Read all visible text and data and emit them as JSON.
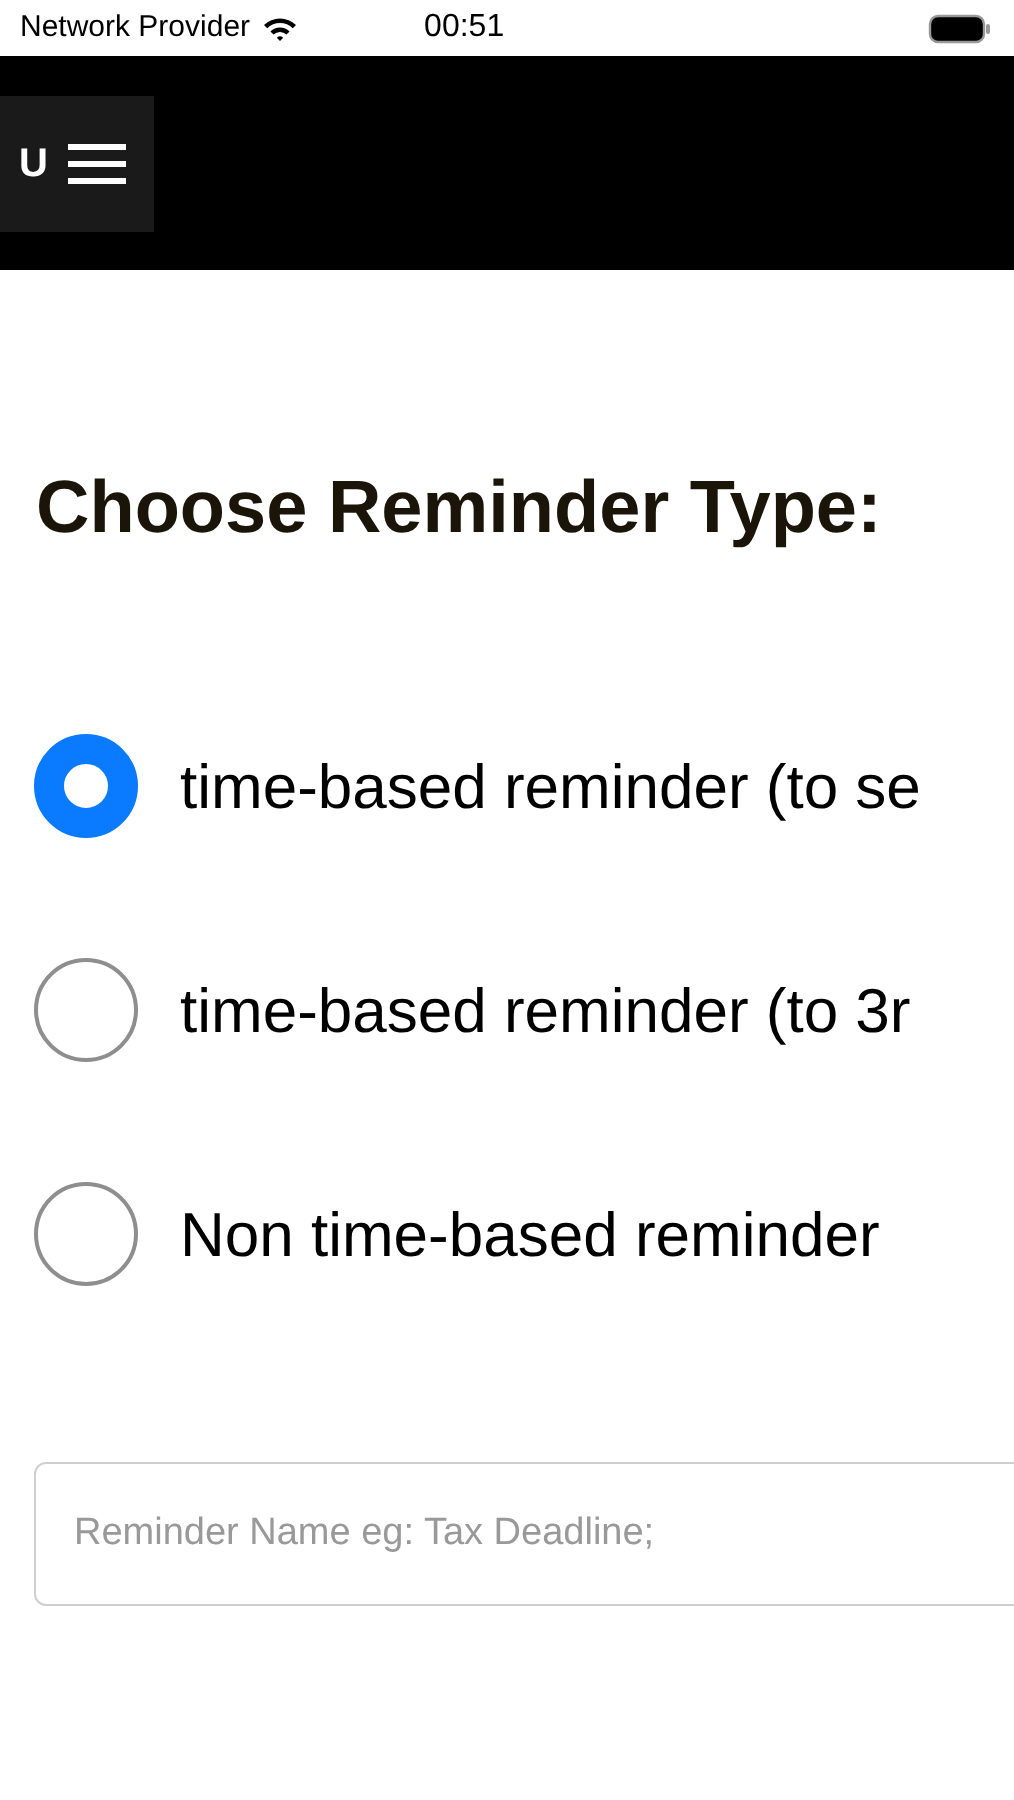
{
  "status_bar": {
    "carrier": "Network Provider",
    "time": "00:51"
  },
  "header": {
    "menu_button": {
      "label": "U"
    }
  },
  "heading": "Choose Reminder Type:",
  "options": [
    {
      "label": "time-based reminder (to se",
      "selected": true
    },
    {
      "label": "time-based reminder (to 3r",
      "selected": false
    },
    {
      "label": "Non time-based reminder",
      "selected": false
    }
  ],
  "name_field": {
    "placeholder": "Reminder Name eg: Tax Deadline;"
  }
}
